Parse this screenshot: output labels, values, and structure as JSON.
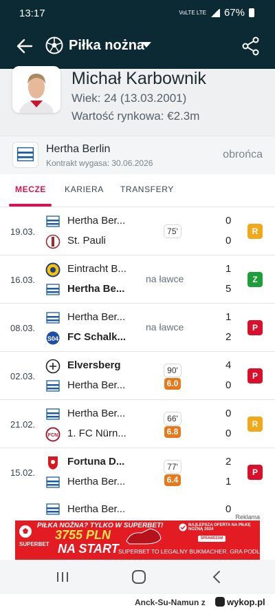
{
  "status": {
    "time": "13:17",
    "network": "VoLTE LTE",
    "battery": "67%"
  },
  "appbar": {
    "title": "Piłka nożna"
  },
  "player": {
    "name": "Michał Karbownik",
    "age": "Wiek: 24 (13.03.2001)",
    "value": "Wartość rynkowa: €2.3m"
  },
  "team": {
    "name": "Hertha Berlin",
    "contract": "Kontrakt wygasa: 30.06.2026",
    "position": "obrońca"
  },
  "tabs": [
    "MECZE",
    "KARIERA",
    "TRANSFERY"
  ],
  "matches": [
    {
      "date": "19.03.",
      "home": "Hertha Ber...",
      "away": "St. Pauli",
      "home_bold": false,
      "away_bold": false,
      "minutes": "75'",
      "rating": "",
      "note": "",
      "home_score": "0",
      "away_score": "0",
      "result": "R",
      "result_color": "#f0a81c"
    },
    {
      "date": "16.03.",
      "home": "Eintracht B...",
      "away": "Hertha Be...",
      "home_bold": false,
      "away_bold": true,
      "minutes": "",
      "rating": "",
      "note": "na ławce",
      "home_score": "1",
      "away_score": "5",
      "result": "Z",
      "result_color": "#1e9e3a"
    },
    {
      "date": "08.03.",
      "home": "Hertha Ber...",
      "away": "FC Schalk...",
      "home_bold": false,
      "away_bold": true,
      "minutes": "",
      "rating": "",
      "note": "na ławce",
      "home_score": "1",
      "away_score": "2",
      "result": "P",
      "result_color": "#d8102b"
    },
    {
      "date": "02.03.",
      "home": "Elversberg",
      "away": "Hertha Ber...",
      "home_bold": true,
      "away_bold": false,
      "minutes": "90'",
      "rating": "6.0",
      "note": "",
      "home_score": "4",
      "away_score": "0",
      "result": "P",
      "result_color": "#d8102b"
    },
    {
      "date": "21.02.",
      "home": "Hertha Ber...",
      "away": "1. FC Nürn...",
      "home_bold": false,
      "away_bold": false,
      "minutes": "66'",
      "rating": "6.8",
      "note": "",
      "home_score": "0",
      "away_score": "0",
      "result": "R",
      "result_color": "#f0a81c"
    },
    {
      "date": "15.02.",
      "home": "Fortuna D...",
      "away": "Hertha Ber...",
      "home_bold": true,
      "away_bold": false,
      "minutes": "77'",
      "rating": "6.4",
      "note": "",
      "home_score": "2",
      "away_score": "1",
      "result": "P",
      "result_color": "#d8102b"
    }
  ],
  "partial_match": {
    "home": "Hertha Ber...",
    "home_score": "0"
  },
  "ad": {
    "label": "Reklama",
    "headline": "PIŁKA NOŻNA? TYLKO W SUPERBET!",
    "amount": "3755 PLN",
    "start": "NA START",
    "brand": "SUPERBET",
    "offer": "NAJLEPSZA OFERTA NA PIŁKĘ NOŻNĄ 2024",
    "button": "SPRAWDZAM",
    "legal": "SUPERBET TO LEGALNY BUKMACHER. GRA PODLEGA KARZE. HAZARD MOŻE UZA"
  },
  "watermark": {
    "user": "Anck-Su-Namun",
    "z": "z",
    "site": "wykop.pl"
  },
  "colors": {
    "header": "#0c2a33",
    "accent": "#d8124f",
    "rating": "#e8781a"
  }
}
